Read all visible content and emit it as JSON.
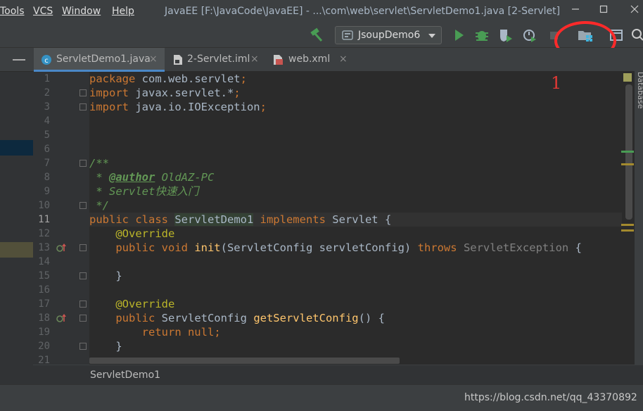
{
  "window": {
    "title": "JavaEE [F:\\JavaCode\\JavaEE] - ...\\com\\web\\servlet\\ServletDemo1.java [2-Servlet]"
  },
  "menu": {
    "items": [
      {
        "label": "Tools"
      },
      {
        "label": "VCS"
      },
      {
        "label": "Window"
      },
      {
        "label": "Help"
      }
    ]
  },
  "toolbar": {
    "run_config": "JsoupDemo6"
  },
  "tabs": [
    {
      "label": "ServletDemo1.java",
      "active": true
    },
    {
      "label": "2-Servlet.iml",
      "active": false
    },
    {
      "label": "web.xml",
      "active": false
    }
  ],
  "tab_close_glyph": "×",
  "editor": {
    "current_line": 11,
    "lines": [
      {
        "n": "1"
      },
      {
        "n": "2"
      },
      {
        "n": "3"
      },
      {
        "n": "4"
      },
      {
        "n": "5"
      },
      {
        "n": "6"
      },
      {
        "n": "7"
      },
      {
        "n": "8"
      },
      {
        "n": "9"
      },
      {
        "n": "10"
      },
      {
        "n": "11"
      },
      {
        "n": "12"
      },
      {
        "n": "13"
      },
      {
        "n": "14"
      },
      {
        "n": "15"
      },
      {
        "n": "16"
      },
      {
        "n": "17"
      },
      {
        "n": "18"
      },
      {
        "n": "19"
      },
      {
        "n": "20"
      },
      {
        "n": "21"
      }
    ],
    "code": {
      "l1_kw": "package",
      "l1_rest": " com.web.servlet",
      "l1_semi": ";",
      "l2_kw": "import",
      "l2_rest": " javax.servlet.*",
      "l2_semi": ";",
      "l3_kw": "import",
      "l3_rest": " java.io.IOException",
      "l3_semi": ";",
      "l7": "/**",
      "l8_star": " * ",
      "l8_tag": "@author",
      "l8_rest": " OldAZ-PC",
      "l9": " * Servlet快速入门",
      "l10": " */",
      "l11_kw1": "public class ",
      "l11_cls": "ServletDemo1",
      "l11_kw2": " implements",
      "l11_rest": " Servlet {",
      "l12": "    @Override",
      "l13_kw": "    public void ",
      "l13_fn": "init",
      "l13_params": "(ServletConfig servletConfig) ",
      "l13_throws": "throws",
      "l13_exc": " ServletException",
      "l13_brace": " {",
      "l15": "    }",
      "l17": "    @Override",
      "l18_kw": "    public ",
      "l18_type": "ServletConfig ",
      "l18_fn": "getServletConfig",
      "l18_rest": "() {",
      "l19_kw": "        return null",
      "l19_semi": ";",
      "l20": "    }"
    }
  },
  "annotation": {
    "number": "1"
  },
  "right_panel": {
    "label": "Database"
  },
  "breadcrumb": {
    "label": "ServletDemo1"
  },
  "watermark": {
    "text": "https://blog.csdn.net/qq_43370892"
  },
  "colors": {
    "accent": "#4a88c7",
    "run_green": "#499c54",
    "highlight_red": "#ff2a2a"
  },
  "icons": [
    "build-hammer-icon",
    "run-config-icon",
    "run-icon",
    "debug-icon",
    "coverage-icon",
    "profile-icon",
    "stop-icon",
    "project-structure-icon",
    "search-icon"
  ]
}
